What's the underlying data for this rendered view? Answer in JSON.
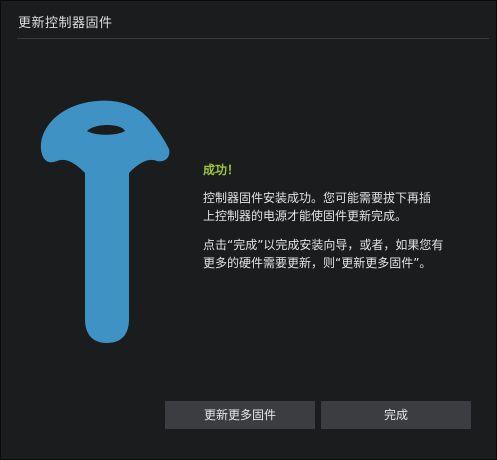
{
  "window": {
    "title": "更新控制器固件"
  },
  "message": {
    "heading": "成功！",
    "para1_line1": "控制器固件安装成功。您可能需要拔下再插",
    "para1_line2": "上控制器的电源才能使固件更新完成。",
    "para2_line1": "点击“完成”以完成安装向导，或者，如果您有",
    "para2_line2": "更多的硬件需要更新，则“更新更多固件”。"
  },
  "buttons": {
    "update_more": "更新更多固件",
    "done": "完成"
  },
  "illustration": {
    "icon": "vive-controller-icon",
    "color": "#3f93c4"
  },
  "colors": {
    "background": "#1b1c1e",
    "success": "#9dc43a",
    "button": "#3c3d40"
  }
}
